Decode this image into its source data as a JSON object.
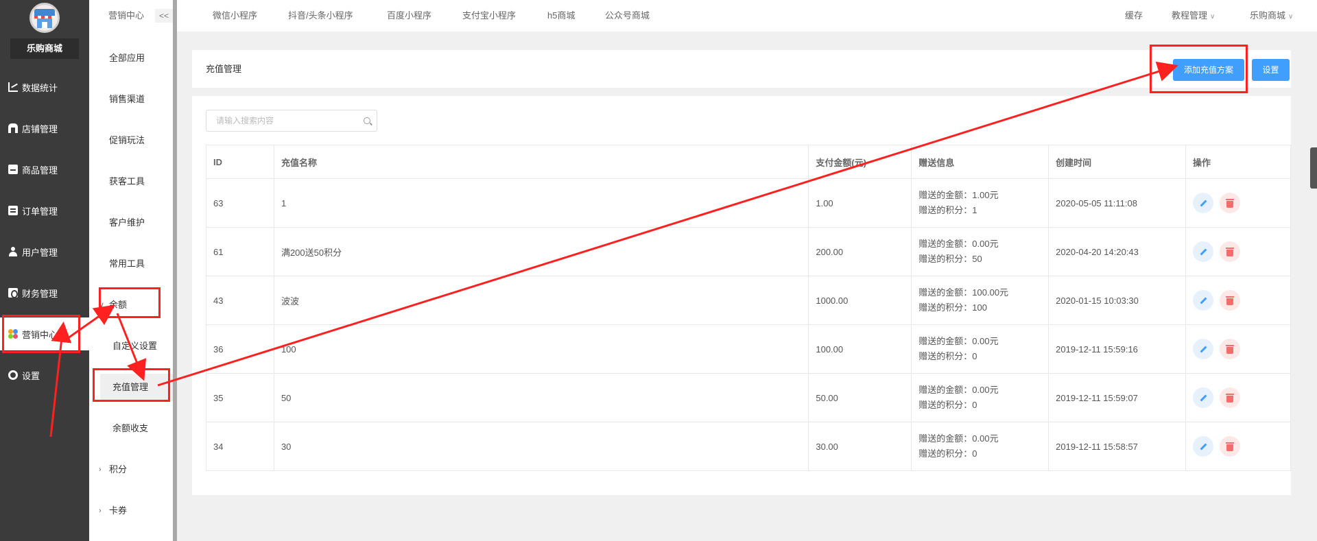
{
  "brand": {
    "shop_name": "乐购商城"
  },
  "sidebar": {
    "items": [
      {
        "label": "数据统计",
        "icon": "chart-icon"
      },
      {
        "label": "店铺管理",
        "icon": "store-icon"
      },
      {
        "label": "商品管理",
        "icon": "goods-icon"
      },
      {
        "label": "订单管理",
        "icon": "order-icon"
      },
      {
        "label": "用户管理",
        "icon": "user-icon"
      },
      {
        "label": "财务管理",
        "icon": "finance-icon"
      },
      {
        "label": "营销中心",
        "icon": "marketing-icon",
        "active": true
      },
      {
        "label": "设置",
        "icon": "gear-icon"
      }
    ]
  },
  "subnav": {
    "title": "营销中心",
    "collapse_label": "<<",
    "items": [
      {
        "label": "全部应用"
      },
      {
        "label": "销售渠道"
      },
      {
        "label": "促销玩法"
      },
      {
        "label": "获客工具"
      },
      {
        "label": "客户维护"
      },
      {
        "label": "常用工具"
      },
      {
        "label": "余额",
        "expanded": true
      },
      {
        "label": "自定义设置"
      },
      {
        "label": "充值管理",
        "selected": true
      },
      {
        "label": "余额收支"
      },
      {
        "label": "积分"
      },
      {
        "label": "卡券"
      }
    ]
  },
  "topnav": {
    "links": [
      "微信小程序",
      "抖音/头条小程序",
      "百度小程序",
      "支付宝小程序",
      "h5商城",
      "公众号商城"
    ],
    "right": {
      "cache": "缓存",
      "tutorial": "教程管理",
      "shop": "乐购商城"
    }
  },
  "page": {
    "title": "充值管理",
    "add_button": "添加充值方案",
    "settings_button": "设置",
    "search_placeholder": "请输入搜索内容"
  },
  "table": {
    "columns": [
      "ID",
      "充值名称",
      "支付金额(元)",
      "赠送信息",
      "创建时间",
      "操作"
    ],
    "rows": [
      {
        "id": "63",
        "name": "1",
        "pay": "1.00",
        "gift_amount": "赠送的金额：1.00元",
        "gift_points": "赠送的积分：1",
        "created": "2020-05-05 11:11:08"
      },
      {
        "id": "61",
        "name": "满200送50积分",
        "pay": "200.00",
        "gift_amount": "赠送的金额：0.00元",
        "gift_points": "赠送的积分：50",
        "created": "2020-04-20 14:20:43"
      },
      {
        "id": "43",
        "name": "波波",
        "pay": "1000.00",
        "gift_amount": "赠送的金额：100.00元",
        "gift_points": "赠送的积分：100",
        "created": "2020-01-15 10:03:30"
      },
      {
        "id": "36",
        "name": "100",
        "pay": "100.00",
        "gift_amount": "赠送的金额：0.00元",
        "gift_points": "赠送的积分：0",
        "created": "2019-12-11 15:59:16"
      },
      {
        "id": "35",
        "name": "50",
        "pay": "50.00",
        "gift_amount": "赠送的金额：0.00元",
        "gift_points": "赠送的积分：0",
        "created": "2019-12-11 15:59:07"
      },
      {
        "id": "34",
        "name": "30",
        "pay": "30.00",
        "gift_amount": "赠送的金额：0.00元",
        "gift_points": "赠送的积分：0",
        "created": "2019-12-11 15:58:57"
      }
    ]
  },
  "colors": {
    "primary": "#409eff",
    "danger": "#f56c6c",
    "annotation": "#ff2020",
    "sidebar_bg": "#3b3b3b"
  }
}
